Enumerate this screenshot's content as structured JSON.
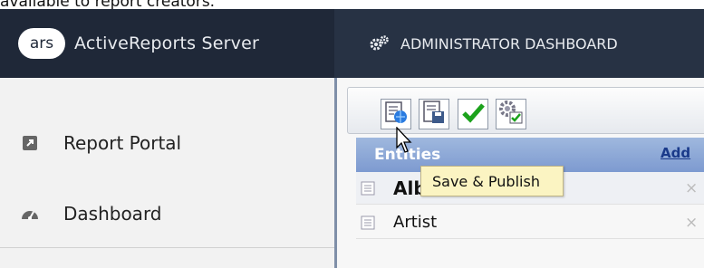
{
  "document": {
    "partial_text": "available to report creators."
  },
  "header": {
    "logo_text": "ars",
    "app_name": "ActiveReports Server",
    "admin_label": "ADMINISTRATOR DASHBOARD",
    "admin_icon": "gears-icon"
  },
  "sidebar": {
    "items": [
      {
        "label": "Report Portal",
        "icon": "external-link-icon"
      },
      {
        "label": "Dashboard",
        "icon": "speedometer-icon"
      }
    ]
  },
  "toolbar": {
    "buttons": [
      {
        "name": "save-publish",
        "icon": "globe-document-icon"
      },
      {
        "name": "save-model",
        "icon": "floppy-document-icon"
      },
      {
        "name": "validate",
        "icon": "checkmark-icon"
      },
      {
        "name": "settings",
        "icon": "gears-check-icon"
      }
    ]
  },
  "tooltip": {
    "text": "Save & Publish"
  },
  "entities": {
    "title": "Entities",
    "add_label": "Add",
    "rows": [
      {
        "label": "Album",
        "bold": true
      },
      {
        "label": "Artist",
        "bold": false
      }
    ],
    "remove_glyph": "×"
  },
  "colors": {
    "header_bg": "#273244",
    "brand_bg": "#1f2838",
    "sidebar_bg": "#f2f2f2",
    "entities_header": "#8aa6d8",
    "tooltip_bg": "#fbf4c2"
  }
}
